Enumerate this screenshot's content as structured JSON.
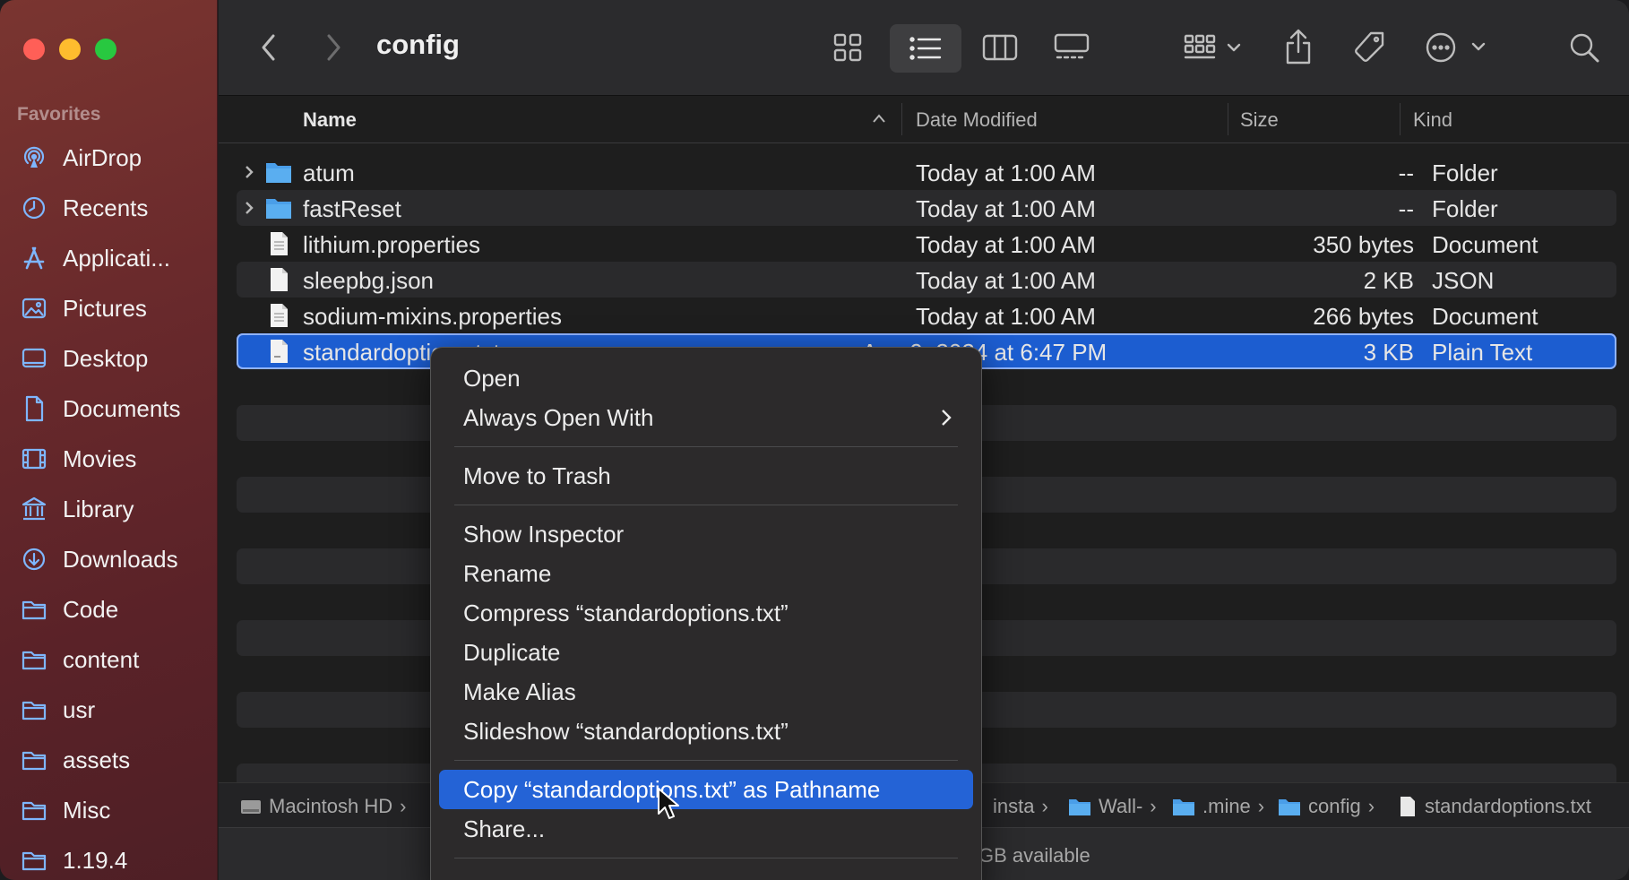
{
  "window": {
    "title": "config"
  },
  "sidebar": {
    "section_title": "Favorites",
    "items": [
      {
        "label": "AirDrop",
        "icon": "airdrop-icon"
      },
      {
        "label": "Recents",
        "icon": "clock-icon"
      },
      {
        "label": "Applicati...",
        "icon": "applications-icon"
      },
      {
        "label": "Pictures",
        "icon": "photo-icon"
      },
      {
        "label": "Desktop",
        "icon": "desktop-icon"
      },
      {
        "label": "Documents",
        "icon": "document-icon"
      },
      {
        "label": "Movies",
        "icon": "film-icon"
      },
      {
        "label": "Library",
        "icon": "library-icon"
      },
      {
        "label": "Downloads",
        "icon": "download-icon"
      },
      {
        "label": "Code",
        "icon": "folder-icon"
      },
      {
        "label": "content",
        "icon": "folder-icon"
      },
      {
        "label": "usr",
        "icon": "folder-icon"
      },
      {
        "label": "assets",
        "icon": "folder-icon"
      },
      {
        "label": "Misc",
        "icon": "folder-icon"
      },
      {
        "label": "1.19.4",
        "icon": "folder-icon"
      }
    ]
  },
  "columns": {
    "name": "Name",
    "date": "Date Modified",
    "size": "Size",
    "kind": "Kind"
  },
  "files": [
    {
      "name": "atum",
      "date": "Today at 1:00 AM",
      "size": "--",
      "kind": "Folder"
    },
    {
      "name": "fastReset",
      "date": "Today at 1:00 AM",
      "size": "--",
      "kind": "Folder"
    },
    {
      "name": "lithium.properties",
      "date": "Today at 1:00 AM",
      "size": "350 bytes",
      "kind": "Document"
    },
    {
      "name": "sleepbg.json",
      "date": "Today at 1:00 AM",
      "size": "2 KB",
      "kind": "JSON"
    },
    {
      "name": "sodium-mixins.properties",
      "date": "Today at 1:00 AM",
      "size": "266 bytes",
      "kind": "Document"
    },
    {
      "name": "standardoptions.txt",
      "date": "Aug 9, 2024 at 6:47 PM",
      "size": "3 KB",
      "kind": "Plain Text"
    }
  ],
  "path_bar": {
    "segments": [
      "Macintosh HD",
      "insta",
      "Wall-",
      ".mine",
      "config",
      "standardoptions.txt"
    ],
    "separator": "›"
  },
  "status": {
    "text": "GB available"
  },
  "context_menu": {
    "open": "Open",
    "always_open_with": "Always Open With",
    "move_to_trash": "Move to Trash",
    "show_inspector": "Show Inspector",
    "rename": "Rename",
    "compress": "Compress “standardoptions.txt”",
    "duplicate": "Duplicate",
    "make_alias": "Make Alias",
    "slideshow": "Slideshow “standardoptions.txt”",
    "copy_pathname": "Copy “standardoptions.txt” as Pathname",
    "share": "Share..."
  },
  "colors": {
    "accent": "#1c5dd0",
    "highlight": "#2463d6",
    "sidebar": "#6a2a2c",
    "folder": "#5aaef0"
  }
}
